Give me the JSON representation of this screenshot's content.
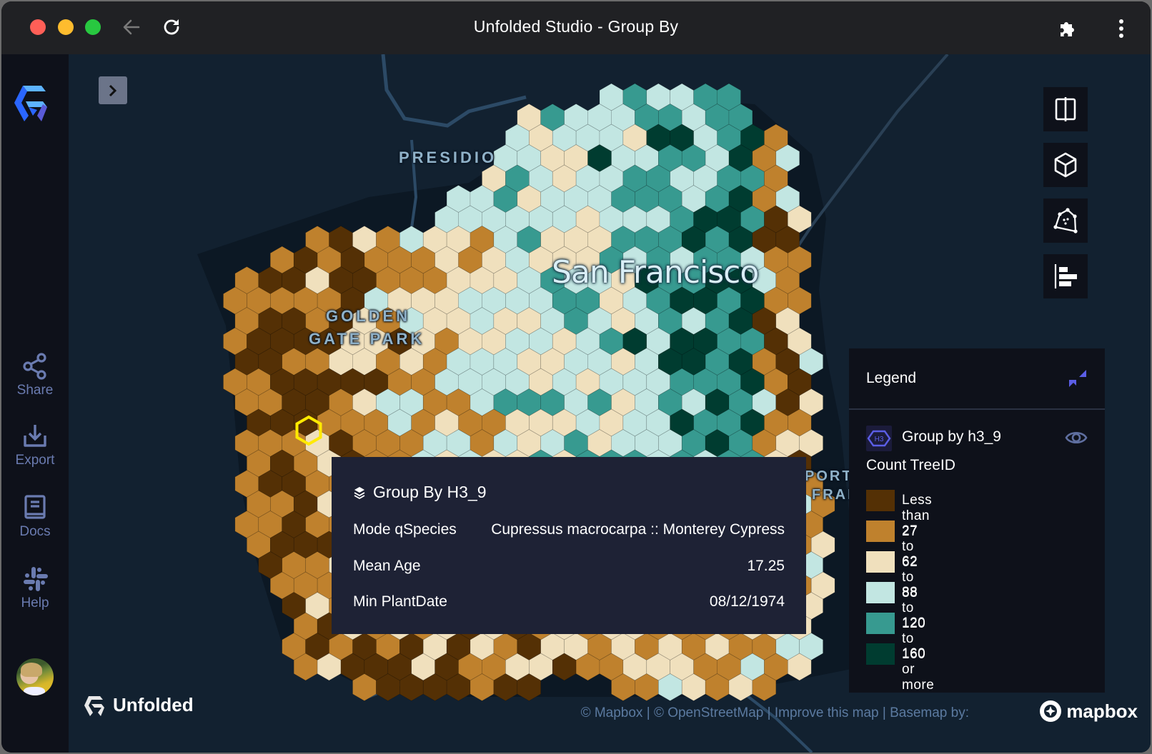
{
  "window": {
    "title": "Unfolded Studio - Group By",
    "controls": [
      "close",
      "minimize",
      "maximize"
    ],
    "nav": {
      "back_icon": "arrow-left",
      "reload_icon": "reload"
    },
    "right_icons": [
      "extension-puzzle",
      "more-vertical"
    ]
  },
  "sidebar": {
    "logo": "unfolded-logo",
    "items": [
      {
        "label": "Share",
        "icon": "share"
      },
      {
        "label": "Export",
        "icon": "download"
      },
      {
        "label": "Docs",
        "icon": "book"
      },
      {
        "label": "Help",
        "icon": "slack"
      }
    ],
    "avatar": "user-avatar"
  },
  "map": {
    "labels": {
      "presidio": "PRESIDIO",
      "golden1": "GOLDEN",
      "golden2": "GATE PARK",
      "city": "San Francisco",
      "port1": "PORT",
      "port2": "FRAN"
    },
    "toolbar": [
      {
        "name": "split-map",
        "icon": "split"
      },
      {
        "name": "3d-view",
        "icon": "cube"
      },
      {
        "name": "draw-polygon",
        "icon": "polygon"
      },
      {
        "name": "legend-toggle",
        "icon": "legend"
      }
    ],
    "brand": "Unfolded",
    "attribution": {
      "mapbox": "© Mapbox",
      "sep1": " | ",
      "osm": "© OpenStreetMap",
      "sep2": " | ",
      "improve": "Improve this map",
      "sep3": " | ",
      "basemap": "Basemap by:"
    },
    "mapbox_logo": "mapbox"
  },
  "legend": {
    "title": "Legend",
    "layer": {
      "badge": "H3",
      "name": "Group by h3_9",
      "visible": true
    },
    "field": "Count TreeID",
    "items": [
      {
        "label": "Less than 27",
        "color": "#543005"
      },
      {
        "label": "27 to 62",
        "color": "#bf812d"
      },
      {
        "label": "62 to 88",
        "color": "#f0e0bd"
      },
      {
        "label": "88 to 120",
        "color": "#c2e6e2"
      },
      {
        "label": "120 to 160",
        "color": "#379a90"
      },
      {
        "label": "160 or more",
        "color": "#003c30"
      }
    ]
  },
  "tooltip": {
    "title": "Group By H3_9",
    "rows": [
      {
        "label": "Mode qSpecies",
        "value": "Cupressus macrocarpa :: Monterey Cypress"
      },
      {
        "label": "Mean Age",
        "value": "17.25"
      },
      {
        "label": "Min PlantDate",
        "value": "08/12/1974"
      }
    ]
  },
  "colors": {
    "accent": "#5b5ee6",
    "highlight": "#ffea00",
    "map_bg": "#122130",
    "panel_bg": "#0e111a",
    "tooltip_bg": "#1e2235"
  }
}
